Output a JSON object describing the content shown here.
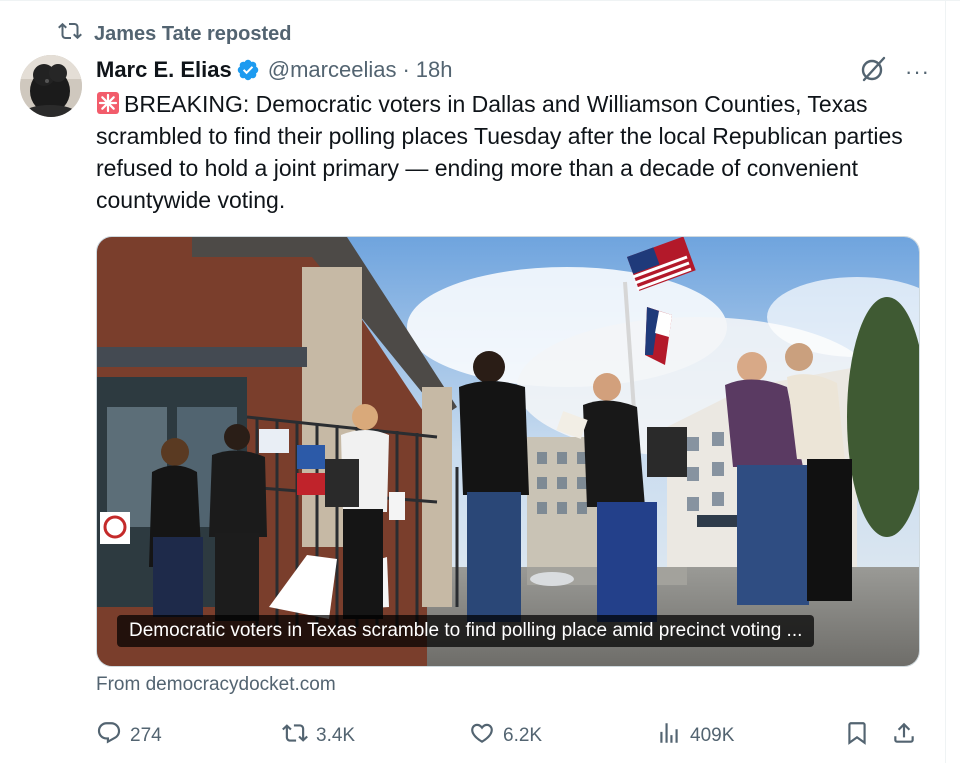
{
  "repost": {
    "text": "James Tate reposted",
    "icon": "retweet-icon"
  },
  "post": {
    "author": {
      "name": "Marc E. Elias",
      "handle": "@marceelias",
      "verified": true
    },
    "separator": "·",
    "time": "18h",
    "text": "BREAKING: Democratic voters in Dallas and Williamson Counties, Texas scrambled to find their polling places Tuesday after the local Republican parties refused to hold a joint primary — ending more than a decade of convenient countywide voting.",
    "more": "···"
  },
  "card": {
    "caption": "Democratic voters in Texas scramble to find polling place amid precinct voting ...",
    "source": "From democracydocket.com"
  },
  "actions": {
    "replies": "274",
    "reposts": "3.4K",
    "likes": "6.2K",
    "views": "409K"
  },
  "colors": {
    "text": "#0f1419",
    "muted": "#536471",
    "verified": "#1d9bf0",
    "border": "#cfd9de"
  }
}
